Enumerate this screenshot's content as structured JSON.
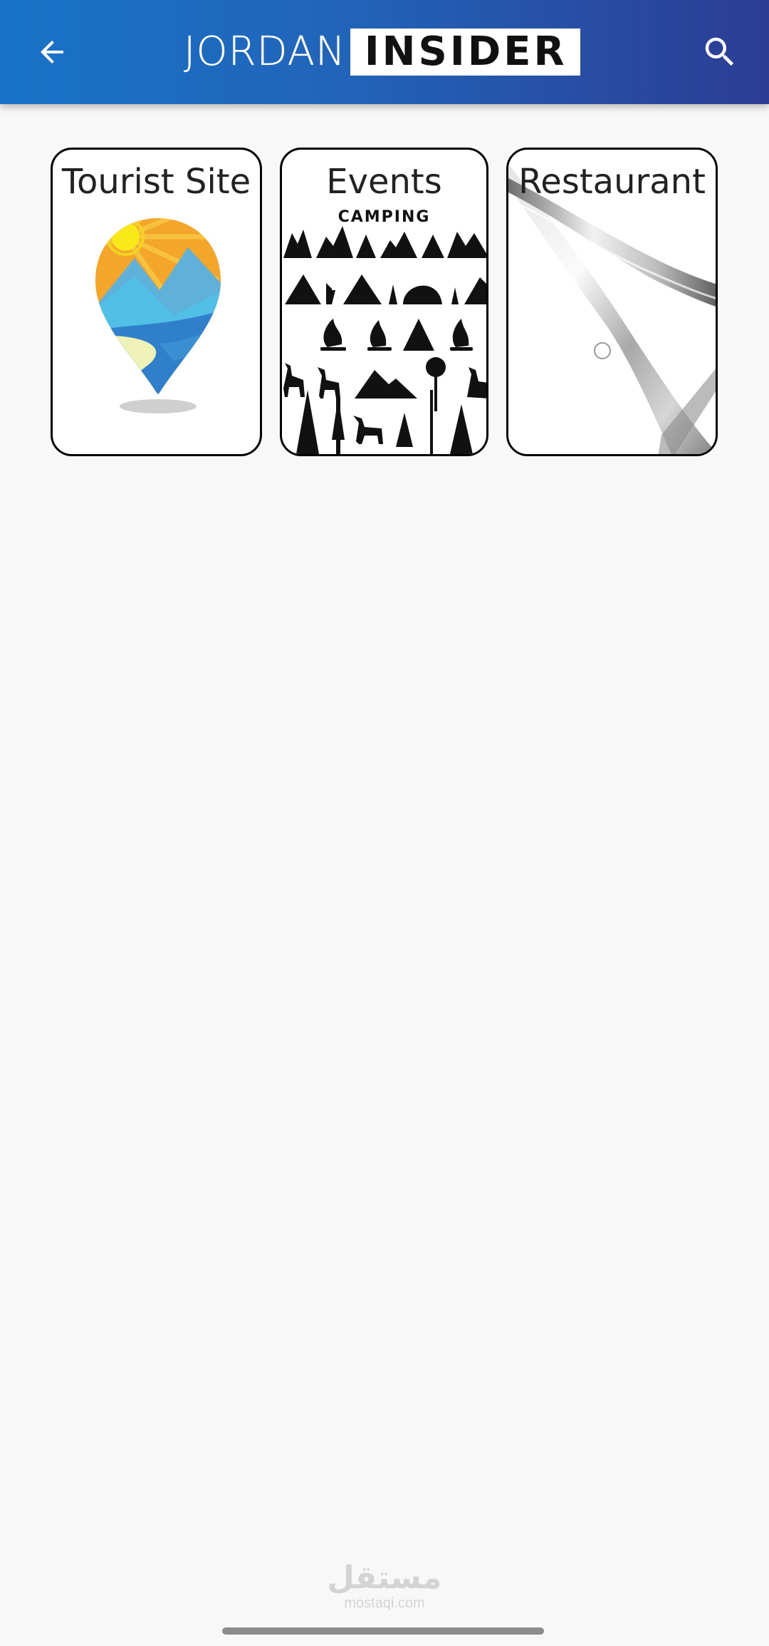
{
  "header": {
    "logo_left": "JORDAN",
    "logo_right": "INSIDER",
    "back_icon": "arrow-back-icon",
    "search_icon": "search-icon",
    "gradient_start": "#1873c8",
    "gradient_end": "#2c3c93"
  },
  "categories": [
    {
      "title": "Tourist Site",
      "image": "map-pin-landscape-icon"
    },
    {
      "title": "Events",
      "image": "camping-silhouettes-image",
      "image_caption": "CAMPING"
    },
    {
      "title": "Restaurant",
      "image": "knife-fork-image"
    }
  ],
  "watermark": {
    "arabic": "مستقل",
    "domain": "mostaqi.com"
  },
  "colors": {
    "background": "#f8f8f8",
    "card_border": "#000000"
  }
}
